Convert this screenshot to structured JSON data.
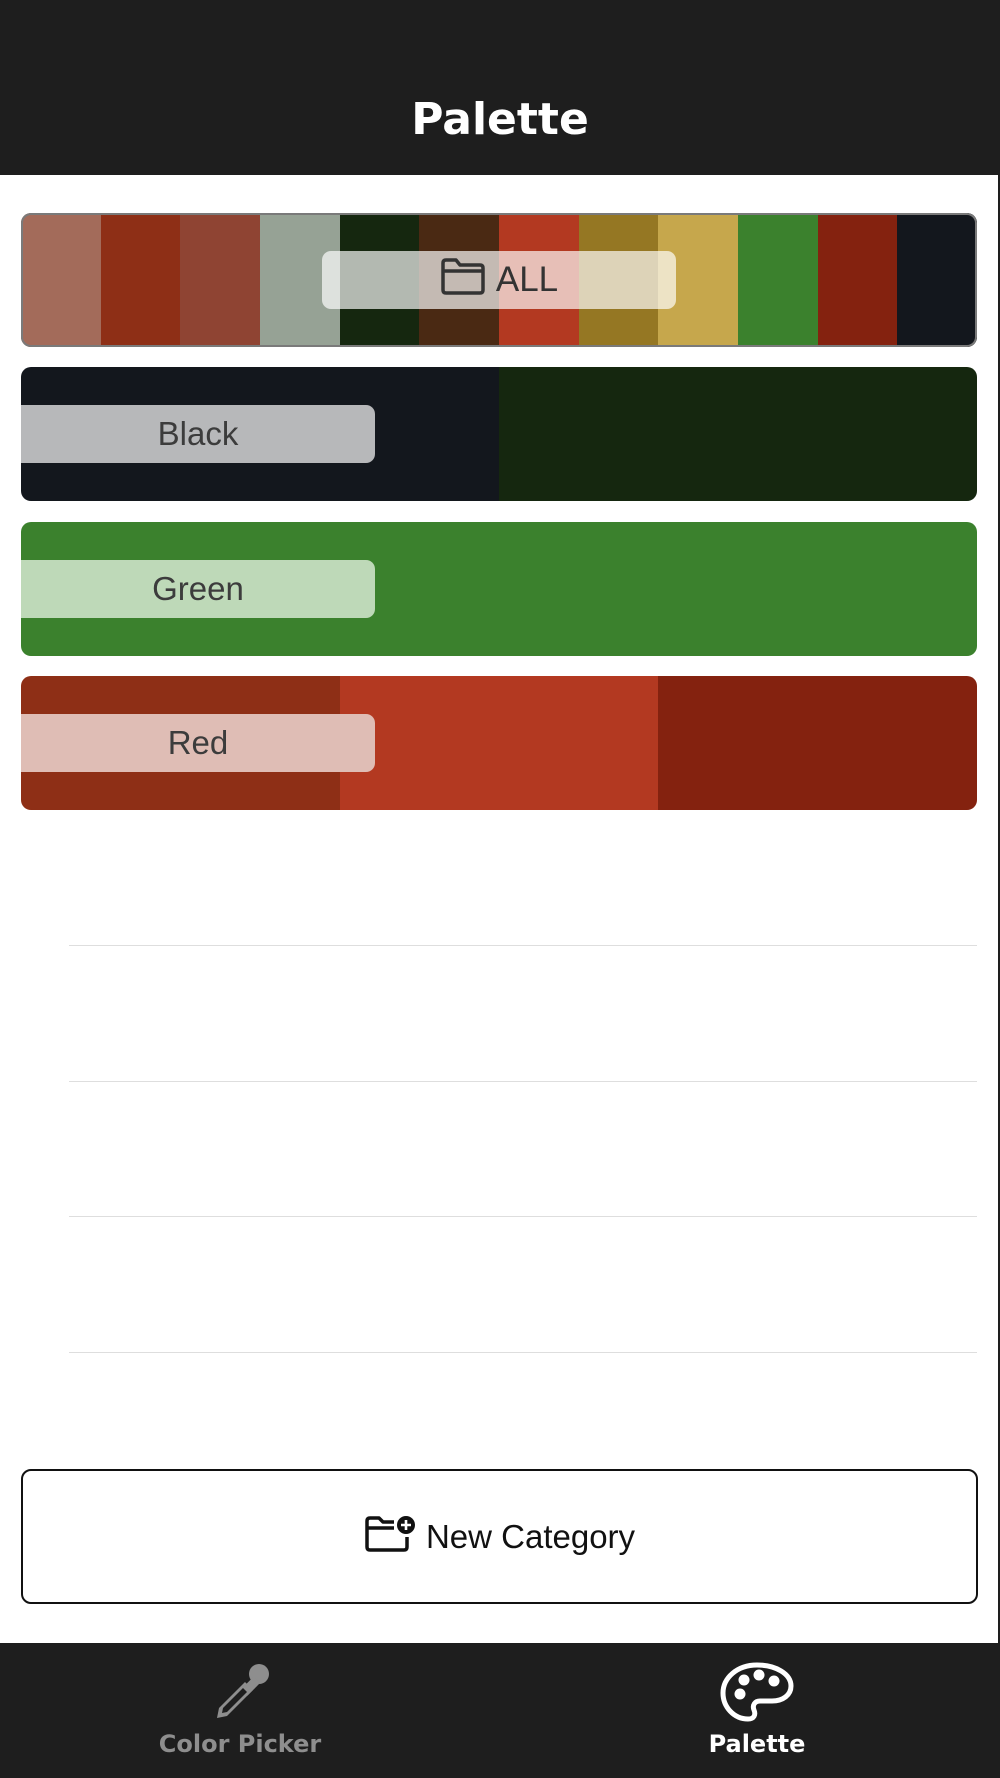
{
  "header": {
    "title": "Palette"
  },
  "categories": {
    "all": {
      "label": "ALL",
      "icon": "folder-icon",
      "swatches": [
        "#a36b5a",
        "#8e2f16",
        "#8f4433",
        "#96a295",
        "#15270f",
        "#4a2913",
        "#b33921",
        "#957723",
        "#c6a74c",
        "#3b812d",
        "#84220f",
        "#13171d"
      ]
    },
    "black": {
      "label": "Black",
      "swatches": [
        "#13171d",
        "#15270f"
      ],
      "pill_color": "#b7b8ba"
    },
    "green": {
      "label": "Green",
      "swatches": [
        "#3b812d"
      ],
      "pill_color": "#bed9b8"
    },
    "red": {
      "label": "Red",
      "swatches": [
        "#8e2f16",
        "#b33921",
        "#84220f"
      ],
      "pill_color": "#dfbdb5"
    }
  },
  "new_category": {
    "label": "New Category",
    "icon": "folder-plus-icon"
  },
  "tabbar": {
    "tabs": [
      {
        "label": "Color Picker",
        "icon": "eyedropper-icon",
        "active": false
      },
      {
        "label": "Palette",
        "icon": "palette-icon",
        "active": true
      }
    ]
  },
  "colors": {
    "bar_bg": "#1e1e1e",
    "inactive_tab": "#8e8e8e",
    "active_tab": "#ffffff"
  }
}
